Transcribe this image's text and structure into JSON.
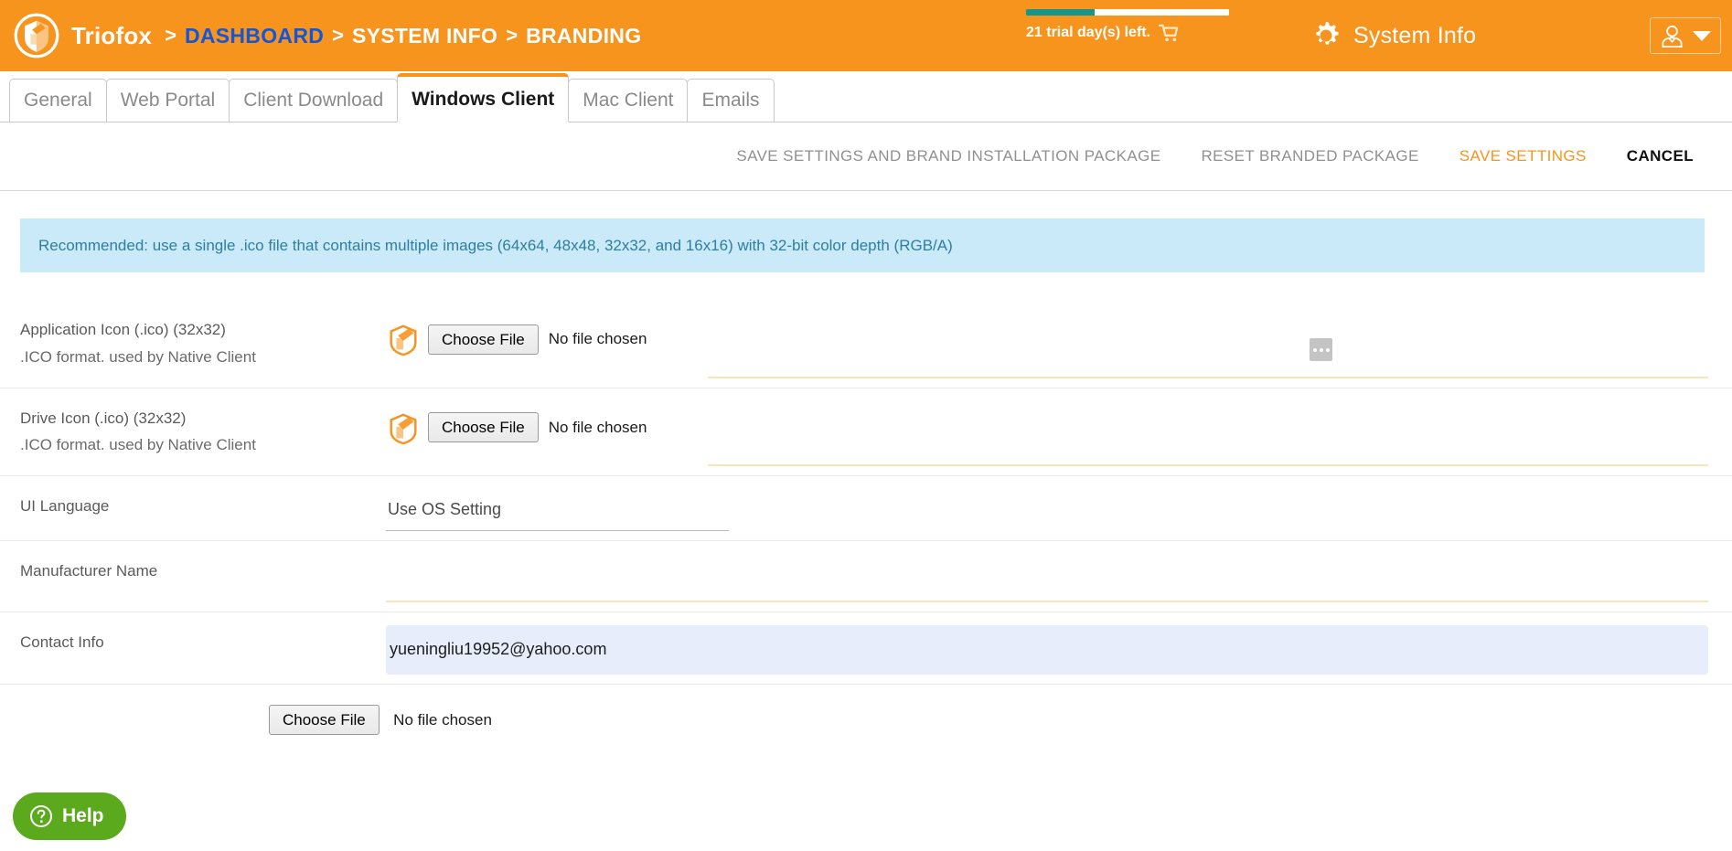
{
  "header": {
    "brand": "Triofox",
    "logo_icon": "triofox-shield-globe-icon",
    "breadcrumb": [
      {
        "label": "DASHBOARD",
        "style": "link"
      },
      {
        "label": "SYSTEM INFO",
        "style": "plain"
      },
      {
        "label": "BRANDING",
        "style": "plain"
      }
    ],
    "separator": ">",
    "trial": {
      "text": "21 trial day(s) left.",
      "progress_percent": 34,
      "bar_fill_color": "#15968B",
      "cart_icon": "shopping-cart-icon"
    },
    "system_info": {
      "label": "System Info",
      "icon": "gear-icon"
    },
    "user_menu": {
      "avatar_icon": "user-avatar-icon",
      "caret_icon": "chevron-down-icon"
    },
    "bar_color": "#F7941E"
  },
  "tabs": [
    {
      "label": "General",
      "active": false
    },
    {
      "label": "Web Portal",
      "active": false
    },
    {
      "label": "Client Download",
      "active": false
    },
    {
      "label": "Windows Client",
      "active": true
    },
    {
      "label": "Mac Client",
      "active": false
    },
    {
      "label": "Emails",
      "active": false
    }
  ],
  "actions": [
    {
      "label": "SAVE SETTINGS AND BRAND INSTALLATION PACKAGE",
      "style": "muted"
    },
    {
      "label": "RESET BRANDED PACKAGE",
      "style": "muted"
    },
    {
      "label": "SAVE SETTINGS",
      "style": "accent"
    },
    {
      "label": "CANCEL",
      "style": "strong"
    }
  ],
  "banner": {
    "text": "Recommended: use a single .ico file that contains multiple images (64x64, 48x48, 32x32, and 16x16) with 32-bit color depth (RGB/A)",
    "background": "#CBEAF9",
    "text_color": "#2E7EA0"
  },
  "form": {
    "rows": [
      {
        "label": "Application Icon (.ico) (32x32)",
        "sublabel": ".ICO format. used by Native Client",
        "type": "file",
        "icon": "triofox-shield-icon",
        "button_label": "Choose File",
        "file_status": "No file chosen",
        "has_ellipsis": true,
        "ellipsis_label": "..."
      },
      {
        "label": "Drive Icon (.ico) (32x32)",
        "sublabel": ".ICO format. used by Native Client",
        "type": "file",
        "icon": "triofox-shield-icon",
        "button_label": "Choose File",
        "file_status": "No file chosen",
        "has_ellipsis": false
      },
      {
        "label": "UI Language",
        "sublabel": "",
        "type": "select",
        "value": "Use OS Setting"
      },
      {
        "label": "Manufacturer Name",
        "sublabel": "",
        "type": "text",
        "value": "",
        "placeholder": ""
      },
      {
        "label": "Contact Info",
        "sublabel": "",
        "type": "text-autofill",
        "value": "yueningliu19952@yahoo.com",
        "placeholder": "",
        "background": "#E8EDFB"
      }
    ],
    "bottom_file": {
      "button_label": "Choose File",
      "file_status": "No file chosen"
    }
  },
  "help_widget": {
    "label": "Help",
    "icon": "question-mark-circle-icon",
    "color": "#5BA91C"
  }
}
